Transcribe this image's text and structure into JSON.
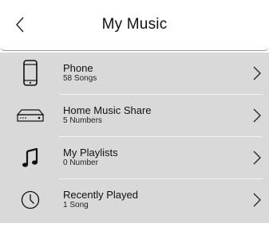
{
  "header": {
    "back_icon": "chevron-left-icon",
    "title": "My Music"
  },
  "items": [
    {
      "icon": "phone-icon",
      "title": "Phone",
      "subtitle": "58 Songs"
    },
    {
      "icon": "network-storage-icon",
      "title": "Home Music Share",
      "subtitle": "5 Numbers"
    },
    {
      "icon": "music-note-icon",
      "title": "My Playlists",
      "subtitle": "0 Number"
    },
    {
      "icon": "clock-icon",
      "title": "Recently Played",
      "subtitle": "1 Song"
    }
  ],
  "colors": {
    "list_background": "#d9d9d9",
    "separator": "#f2f2f2",
    "text": "#111111"
  }
}
